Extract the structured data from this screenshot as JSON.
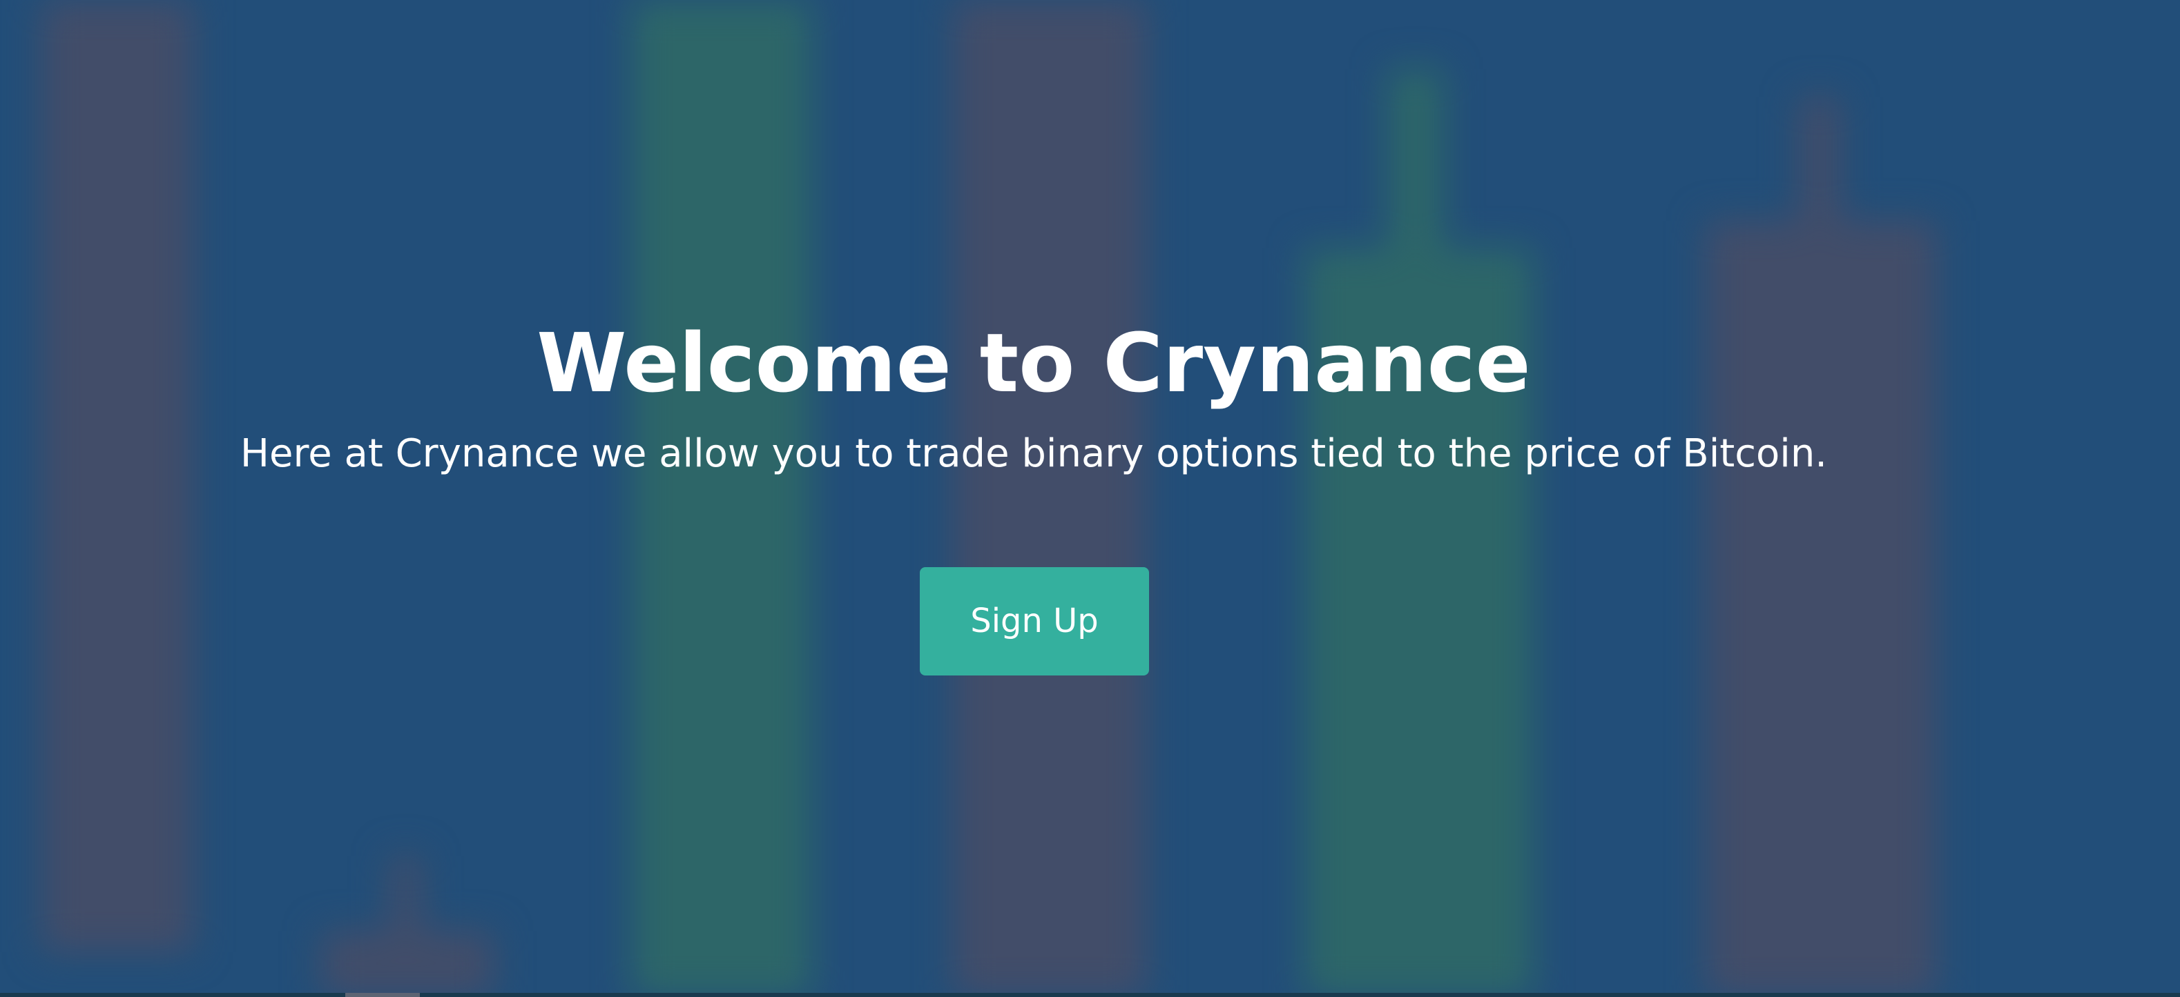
{
  "hero": {
    "title": "Welcome to Crynance",
    "subtitle": "Here at Crynance we allow you to trade binary options tied to the price of Bitcoin.",
    "signup_label": "Sign Up"
  },
  "colors": {
    "background": "#23507b",
    "candle_red": "#464f6a",
    "candle_green": "#2f6a69",
    "button": "#34b09e",
    "text": "#ffffff"
  }
}
